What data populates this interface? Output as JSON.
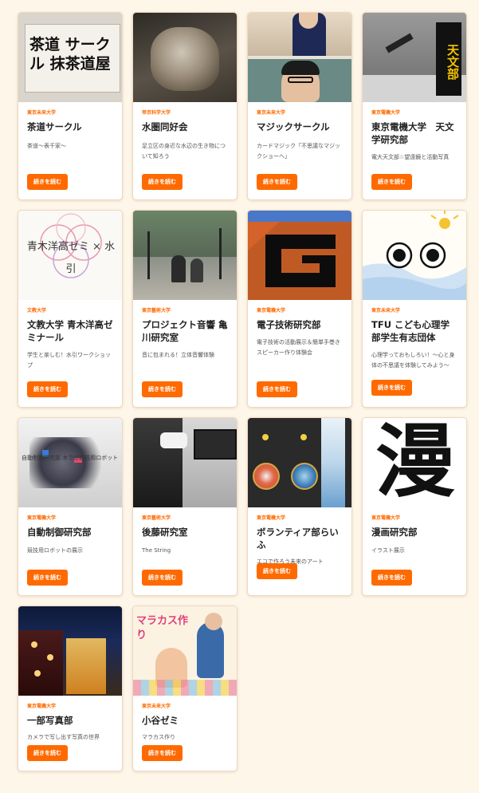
{
  "button_label": "続きを読む",
  "accent_color": "#ff6a00",
  "cards": [
    {
      "university": "東京未来大学",
      "title": "茶道サークル",
      "desc": "茶道〜表千家〜",
      "thumb_text": "茶道 サークル 抹茶道屋"
    },
    {
      "university": "帝京科学大学",
      "title": "水圏同好会",
      "desc": "足立区の身近な水辺の生き物について知ろう",
      "thumb_text": ""
    },
    {
      "university": "東京未来大学",
      "title": "マジックサークル",
      "desc": "カードマジック「不思議なマジックショーへ」",
      "thumb_text": ""
    },
    {
      "university": "東京電機大学",
      "title": "東京電機大学　天文学研究部",
      "desc": "電大天文部☆望遠鏡と活動写真",
      "thumb_text": "天文部"
    },
    {
      "university": "文教大学",
      "title": "文教大学 青木洋高ゼミナール",
      "desc": "学生と楽しむ！水引ワークショップ",
      "thumb_text": "青木洋高ゼミ × 水引"
    },
    {
      "university": "東京藝術大学",
      "title": "プロジェクト音響 亀川研究室",
      "desc": "音に包まれる！立体音響体験",
      "thumb_text": ""
    },
    {
      "university": "東京電機大学",
      "title": "電子技術研究部",
      "desc": "電子技術の活動展示＆簡単手巻きスピーカー作り体験会",
      "thumb_text": ""
    },
    {
      "university": "東京未来大学",
      "title": "TFU こども心理学部学生有志団体",
      "desc": "心理学っておもしろい！〜心と身体の不思議を体験してみよう〜",
      "thumb_text": ""
    },
    {
      "university": "東京電機大学",
      "title": "自動制御研究部",
      "desc": "競技用ロボットの展示",
      "thumb_text": "自動制御研究部 木での競技用ロボット"
    },
    {
      "university": "東京藝術大学",
      "title": "後藤研究室",
      "desc": "The String",
      "thumb_text": ""
    },
    {
      "university": "東京電機大学",
      "title": "ボランティア部らいふ",
      "desc": "エコで作ろう未来のアート",
      "thumb_text": ""
    },
    {
      "university": "東京電機大学",
      "title": "漫画研究部",
      "desc": "イラスト展示",
      "thumb_text": "漫"
    },
    {
      "university": "東京電機大学",
      "title": "一部写真部",
      "desc": "カメラで写し出す写真の世界",
      "thumb_text": ""
    },
    {
      "university": "東京未来大学",
      "title": "小谷ゼミ",
      "desc": "マラカス作り",
      "thumb_text": "マラカス作り"
    }
  ]
}
